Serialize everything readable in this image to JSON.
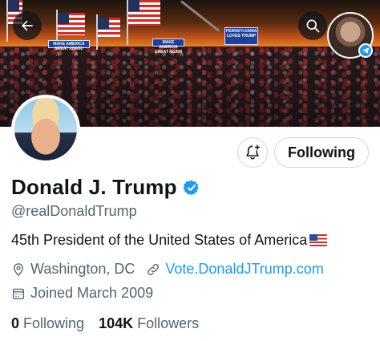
{
  "header": {
    "back_icon": "arrow-left-icon",
    "search_icon": "search-icon",
    "banner_signs": [
      "MAKE AMERICA GREAT AGAIN!",
      "PENNSYLVANIA LOVES TRUMP",
      "MAKE AMERICA GREAT AGAIN"
    ]
  },
  "profile": {
    "name": "Donald J. Trump",
    "verified": true,
    "handle": "@realDonaldTrump",
    "bio": "45th President of the United States of America",
    "location": "Washington, DC",
    "website": "Vote.DonaldJTrump.com",
    "joined": "Joined March 2009",
    "following_count": "0",
    "following_label": "Following",
    "followers_count": "104K",
    "followers_label": "Followers"
  },
  "actions": {
    "follow_button_label": "Following",
    "notify_icon": "bell-plus-icon"
  },
  "colors": {
    "accent": "#1d9bf0",
    "text_primary": "#0f1419",
    "text_secondary": "#536471",
    "border": "#cfd9de"
  }
}
